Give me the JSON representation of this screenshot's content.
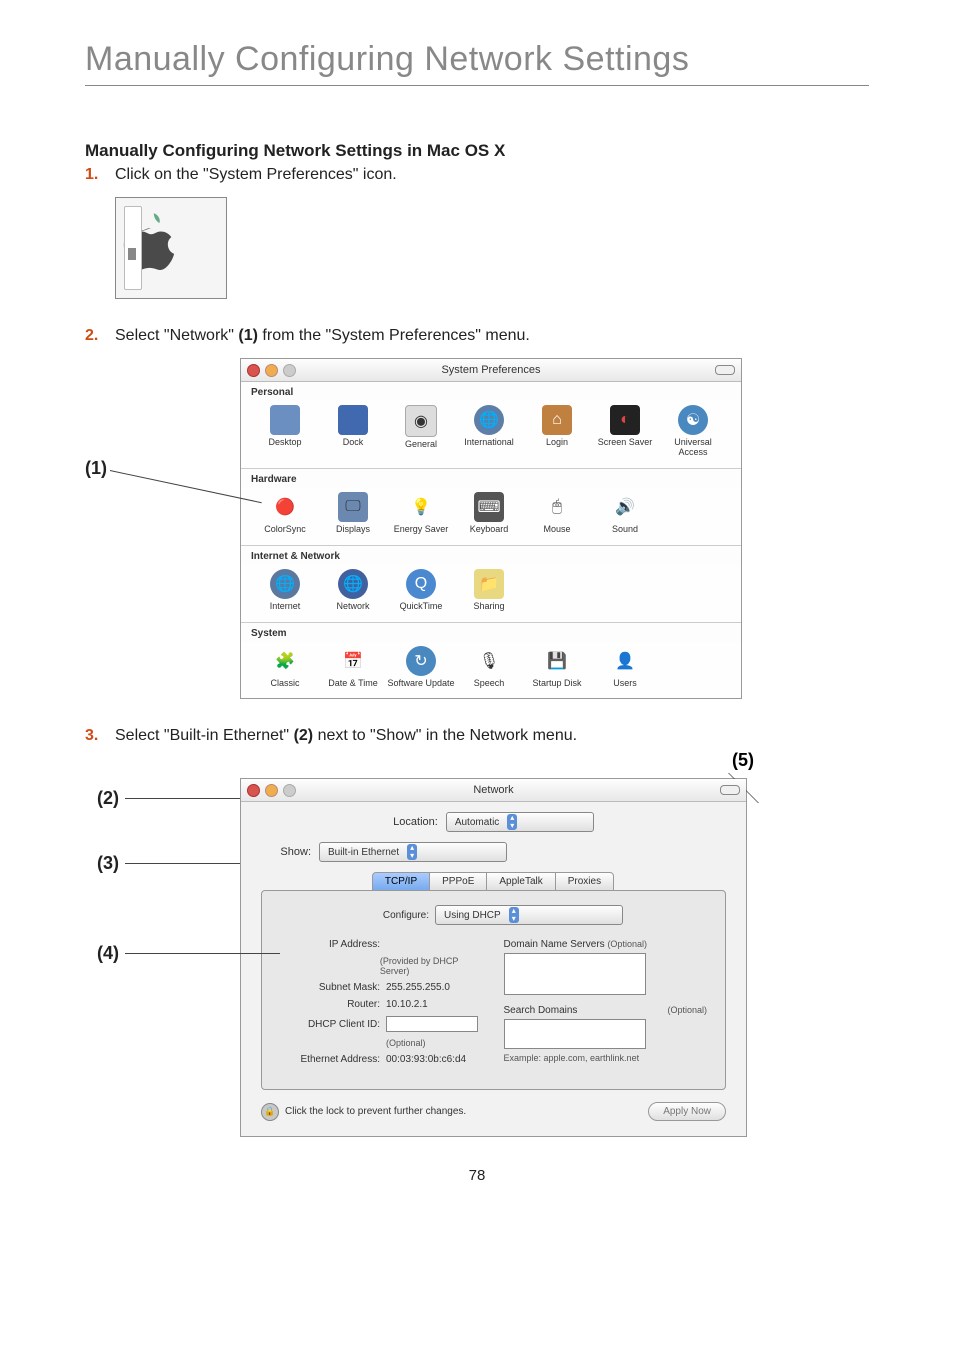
{
  "page": {
    "title": "Manually Configuring Network Settings",
    "section_heading": "Manually Configuring Network Settings in Mac OS X",
    "page_number": "78"
  },
  "steps": {
    "s1": {
      "num": "1.",
      "text": "Click on the \"System Preferences\" icon."
    },
    "s2": {
      "num": "2.",
      "text_a": "Select \"Network\" ",
      "callout": "(1)",
      "text_b": " from the \"System Preferences\" menu."
    },
    "s3": {
      "num": "3.",
      "text_a": "Select \"Built-in Ethernet\" ",
      "callout": "(2)",
      "text_b": " next to \"Show\" in the Network menu."
    }
  },
  "callouts": {
    "c1": "(1)",
    "c2": "(2)",
    "c3": "(3)",
    "c4": "(4)",
    "c5": "(5)"
  },
  "syspref": {
    "title": "System Preferences",
    "sections": {
      "personal": {
        "label": "Personal",
        "items": [
          "Desktop",
          "Dock",
          "General",
          "International",
          "Login",
          "Screen Saver",
          "Universal Access"
        ]
      },
      "hardware": {
        "label": "Hardware",
        "items": [
          "ColorSync",
          "Displays",
          "Energy Saver",
          "Keyboard",
          "Mouse",
          "Sound"
        ]
      },
      "internet": {
        "label": "Internet & Network",
        "items": [
          "Internet",
          "Network",
          "QuickTime",
          "Sharing"
        ]
      },
      "system": {
        "label": "System",
        "items": [
          "Classic",
          "Date & Time",
          "Software Update",
          "Speech",
          "Startup Disk",
          "Users"
        ]
      }
    }
  },
  "network": {
    "title": "Network",
    "location_label": "Location:",
    "location_value": "Automatic",
    "show_label": "Show:",
    "show_value": "Built-in Ethernet",
    "tabs": [
      "TCP/IP",
      "PPPoE",
      "AppleTalk",
      "Proxies"
    ],
    "configure_label": "Configure:",
    "configure_value": "Using DHCP",
    "ip_label": "IP Address:",
    "ip_note": "(Provided by DHCP Server)",
    "subnet_label": "Subnet Mask:",
    "subnet_value": "255.255.255.0",
    "router_label": "Router:",
    "router_value": "10.10.2.1",
    "dhcp_label": "DHCP Client ID:",
    "dhcp_note": "(Optional)",
    "eth_label": "Ethernet Address:",
    "eth_value": "00:03:93:0b:c6:d4",
    "dns_label": "Domain Name Servers",
    "dns_note": "(Optional)",
    "search_label": "Search Domains",
    "search_note": "(Optional)",
    "example": "Example: apple.com, earthlink.net",
    "lock_text": "Click the lock to prevent further changes.",
    "apply": "Apply Now"
  }
}
